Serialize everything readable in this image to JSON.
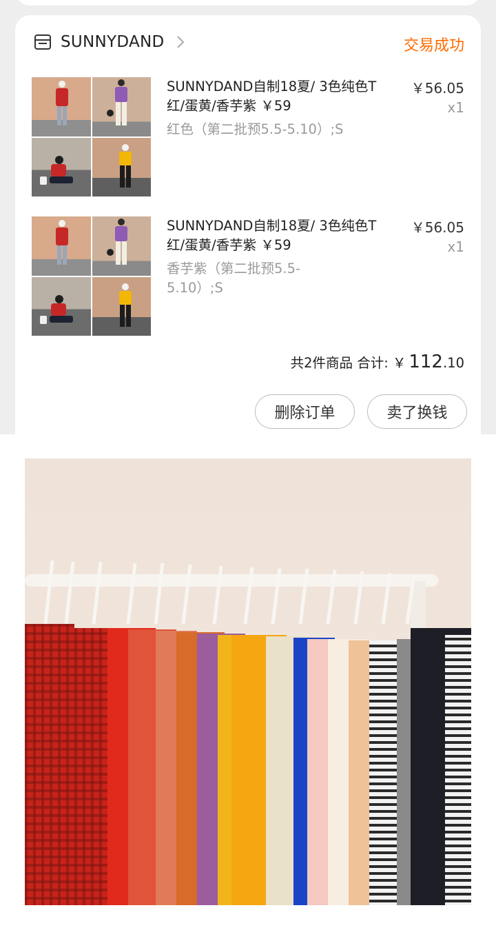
{
  "order": {
    "shop_name": "SUNNYDAND",
    "status": "交易成功",
    "items": [
      {
        "title": "SUNNYDAND自制18夏/ 3色纯色T 红/蛋黄/香芋紫 ￥59",
        "spec": "红色（第二批预5.5-5.10）;S",
        "price": "￥56.05",
        "qty": "x1"
      },
      {
        "title": "SUNNYDAND自制18夏/ 3色纯色T 红/蛋黄/香芋紫 ￥59",
        "spec": "香芋紫（第二批预5.5-5.10）;S",
        "price": "￥56.05",
        "qty": "x1"
      }
    ],
    "summary": {
      "label": "共2件商品 合计:",
      "currency": "￥",
      "total_int": "112",
      "total_dec": ".10"
    },
    "buttons": {
      "delete": "删除订单",
      "sell": "卖了换钱"
    }
  },
  "colors": {
    "accent": "#ff6a00",
    "page_bg": "#eeeeee"
  },
  "icons": {
    "shop": "store-icon",
    "chevron": "chevron-right-icon"
  }
}
